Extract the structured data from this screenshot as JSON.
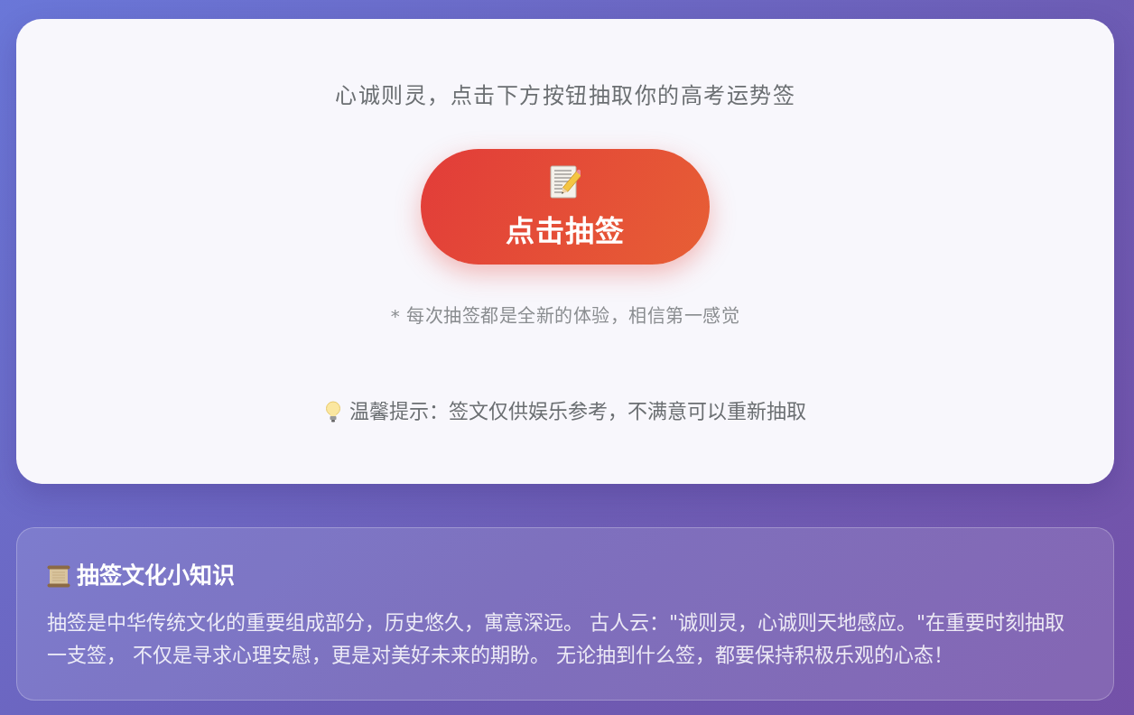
{
  "main_card": {
    "subtitle": "心诚则灵，点击下方按钮抽取你的高考运势签",
    "draw_button": {
      "label": "点击抽签"
    },
    "note": "* 每次抽签都是全新的体验，相信第一感觉",
    "tip": "温馨提示：签文仅供娱乐参考，不满意可以重新抽取"
  },
  "info_card": {
    "title": "抽签文化小知识",
    "body": "抽签是中华传统文化的重要组成部分，历史悠久，寓意深远。 古人云：\"诚则灵，心诚则天地感应。\"在重要时刻抽取一支签， 不仅是寻求心理安慰，更是对美好未来的期盼。 无论抽到什么签，都要保持积极乐观的心态！"
  }
}
